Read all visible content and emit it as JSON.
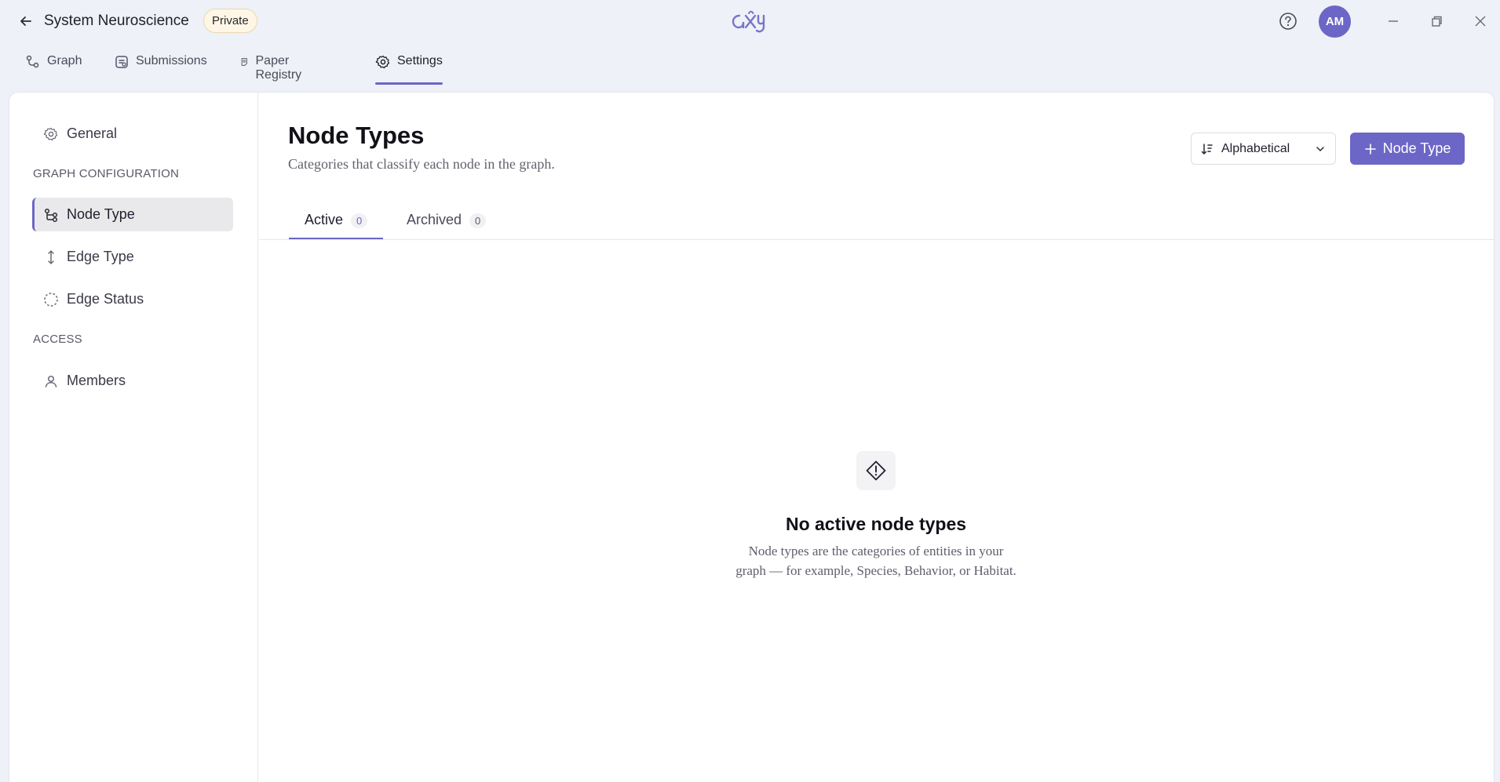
{
  "header": {
    "title": "System Neuroscience",
    "visibility_badge": "Private",
    "logo_text": "axy",
    "avatar_initials": "AM"
  },
  "nav_tabs": [
    {
      "label": "Graph",
      "icon": "graph-icon"
    },
    {
      "label": "Submissions",
      "icon": "submissions-icon"
    },
    {
      "label": "Paper Registry",
      "icon": "paper-icon"
    },
    {
      "label": "Settings",
      "icon": "gear-icon",
      "active": true
    }
  ],
  "sidebar": {
    "general_label": "General",
    "section_graph": "GRAPH CONFIGURATION",
    "items": [
      {
        "label": "Node Type",
        "icon": "node-type-icon",
        "active": true
      },
      {
        "label": "Edge Type",
        "icon": "edge-type-icon"
      },
      {
        "label": "Edge Status",
        "icon": "edge-status-icon"
      }
    ],
    "section_access": "ACCESS",
    "members_label": "Members"
  },
  "main": {
    "title": "Node Types",
    "subtitle": "Categories that classify each node in the graph.",
    "sort_value": "Alphabetical",
    "add_button_label": "Node Type",
    "tabs": [
      {
        "label": "Active",
        "count": "0",
        "active": true
      },
      {
        "label": "Archived",
        "count": "0"
      }
    ],
    "empty_title": "No active node types",
    "empty_desc_line1": "Node types are the categories of entities in your",
    "empty_desc_line2": "graph — for example, Species, Behavior, or Habitat."
  },
  "colors": {
    "accent": "#6c66c7",
    "background": "#eef1f7",
    "badge_bg": "#fff6e6"
  }
}
